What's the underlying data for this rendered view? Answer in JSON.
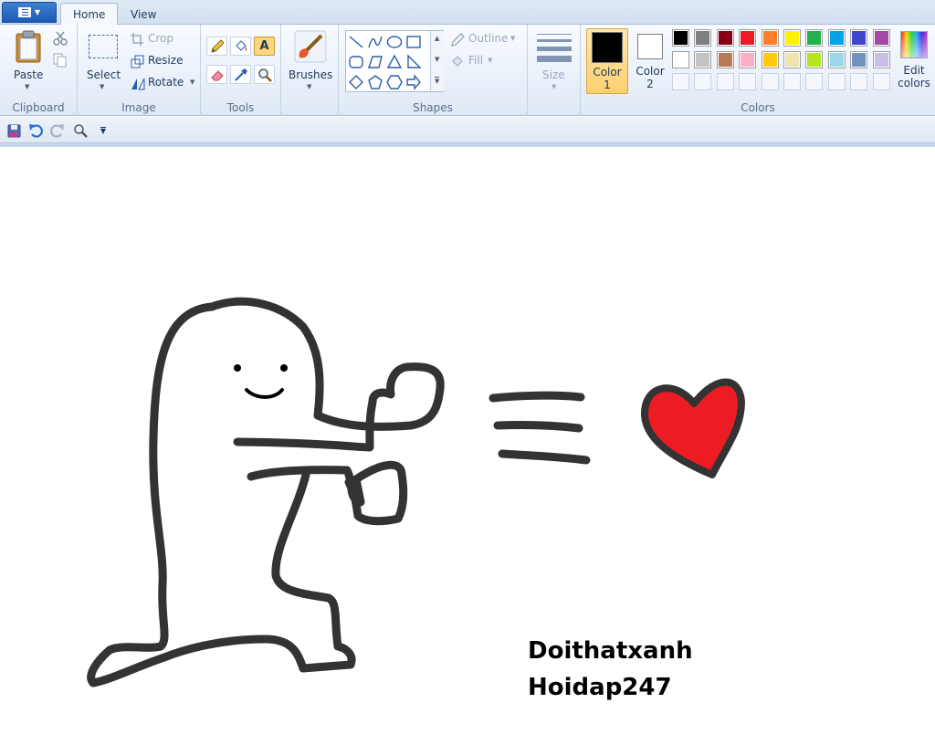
{
  "tabs": {
    "home": "Home",
    "view": "View"
  },
  "clipboard": {
    "paste": "Paste",
    "group": "Clipboard"
  },
  "image": {
    "select": "Select",
    "crop": "Crop",
    "resize": "Resize",
    "rotate": "Rotate",
    "group": "Image"
  },
  "tools": {
    "group": "Tools",
    "text_tool": "A"
  },
  "brushes": {
    "label": "Brushes"
  },
  "shapes": {
    "outline": "Outline",
    "fill": "Fill",
    "group": "Shapes"
  },
  "size": {
    "label": "Size"
  },
  "colors": {
    "color1_line1": "Color",
    "color1_line2": "1",
    "color2_line1": "Color",
    "color2_line2": "2",
    "edit_line1": "Edit",
    "edit_line2": "colors",
    "group": "Colors",
    "color1": "#000000",
    "color2": "#ffffff",
    "palette_row1": [
      "#000000",
      "#7f7f7f",
      "#880015",
      "#ed1c24",
      "#ff7f27",
      "#fff200",
      "#22b14c",
      "#00a2e8",
      "#3f48cc",
      "#a349a4"
    ],
    "palette_row2": [
      "#ffffff",
      "#c3c3c3",
      "#b97a57",
      "#ffaec9",
      "#ffc90e",
      "#efe4b0",
      "#b5e61d",
      "#99d9ea",
      "#7092be",
      "#c8bfe7"
    ]
  },
  "canvas": {
    "line1": "Doithatxanh",
    "line2": "Hoidap247",
    "heart_color": "#ed1c24",
    "stroke_color": "#333333"
  }
}
